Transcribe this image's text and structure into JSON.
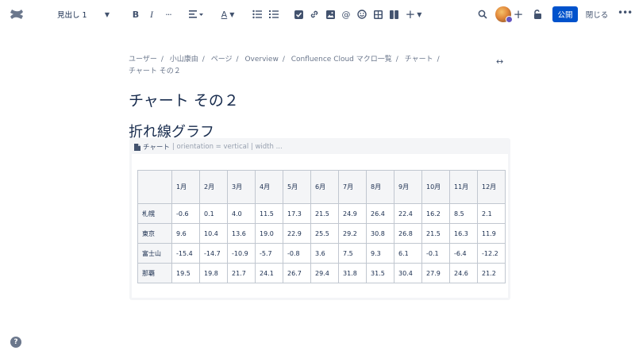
{
  "toolbar": {
    "heading_style": "見出し 1",
    "bold": "B",
    "italic": "I",
    "more_text": "···",
    "text_color_letter": "A",
    "publish_label": "公開",
    "close_label": "閉じる"
  },
  "breadcrumb": [
    "ユーザー",
    "小山康由",
    "ページ",
    "Overview",
    "Confluence Cloud マクロ一覧",
    "チャート",
    "チャート その２"
  ],
  "page_title": "チャート その２",
  "section_title": "折れ線グラフ",
  "macro": {
    "name": "チャート",
    "params": "| orientation = vertical | width ..."
  },
  "table": {
    "months": [
      "1月",
      "2月",
      "3月",
      "4月",
      "5月",
      "6月",
      "7月",
      "8月",
      "9月",
      "10月",
      "11月",
      "12月"
    ],
    "rows": [
      {
        "city": "札幌",
        "values": [
          "-0.6",
          "0.1",
          "4.0",
          "11.5",
          "17.3",
          "21.5",
          "24.9",
          "26.4",
          "22.4",
          "16.2",
          "8.5",
          "2.1"
        ]
      },
      {
        "city": "東京",
        "values": [
          "9.6",
          "10.4",
          "13.6",
          "19.0",
          "22.9",
          "25.5",
          "29.2",
          "30.8",
          "26.8",
          "21.5",
          "16.3",
          "11.9"
        ]
      },
      {
        "city": "富士山",
        "values": [
          "-15.4",
          "-14.7",
          "-10.9",
          "-5.7",
          "-0.8",
          "3.6",
          "7.5",
          "9.3",
          "6.1",
          "-0.1",
          "-6.4",
          "-12.2"
        ]
      },
      {
        "city": "那覇",
        "values": [
          "19.5",
          "19.8",
          "21.7",
          "24.1",
          "26.7",
          "29.4",
          "31.8",
          "31.5",
          "30.4",
          "27.9",
          "24.6",
          "21.2"
        ]
      }
    ]
  },
  "help_label": "?"
}
